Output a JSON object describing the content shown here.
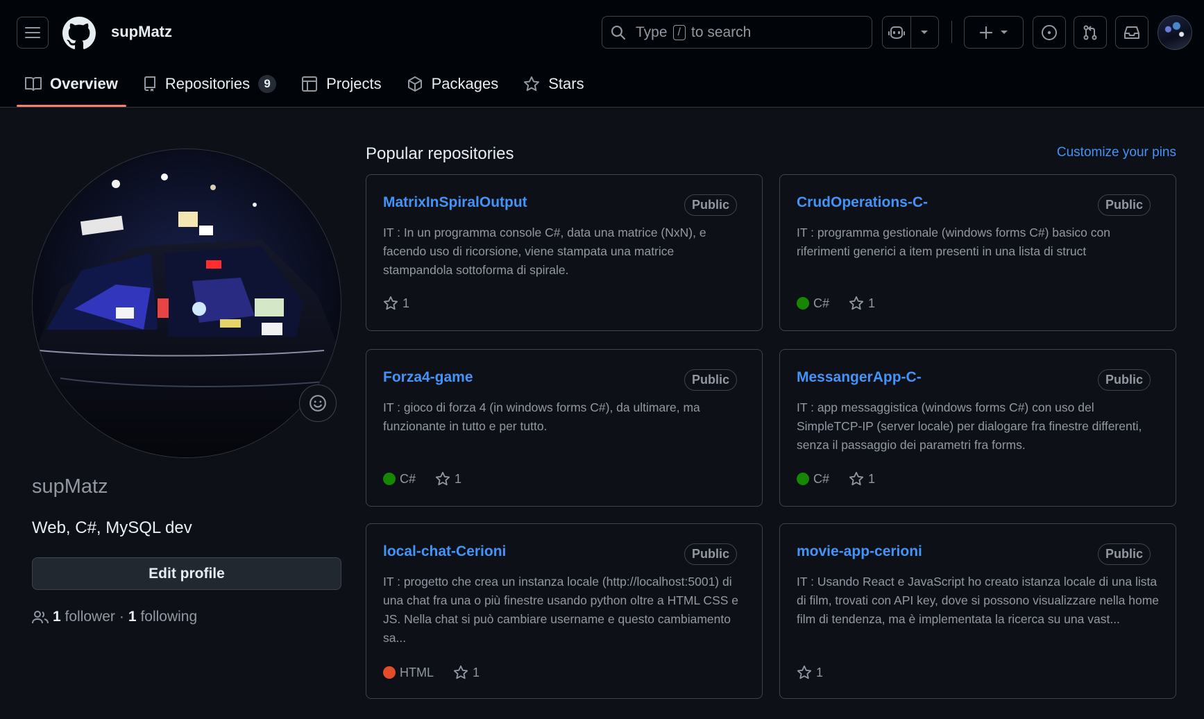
{
  "header": {
    "username": "supMatz",
    "search": {
      "prefix": "Type",
      "key": "/",
      "suffix": "to search"
    }
  },
  "tabs": [
    {
      "label": "Overview",
      "active": true
    },
    {
      "label": "Repositories",
      "count": "9"
    },
    {
      "label": "Projects"
    },
    {
      "label": "Packages"
    },
    {
      "label": "Stars"
    }
  ],
  "profile": {
    "login": "supMatz",
    "bio": "Web, C#, MySQL dev",
    "edit_label": "Edit profile",
    "followers_count": "1",
    "followers_label": "follower",
    "separator": "·",
    "following_count": "1",
    "following_label": "following"
  },
  "popular": {
    "title": "Popular repositories",
    "customize_label": "Customize your pins",
    "repos": [
      {
        "name": "MatrixInSpiralOutput",
        "visibility": "Public",
        "description": "IT : In un programma console C#, data una matrice (NxN), e facendo uso di ricorsione, viene stampata una matrice stampandola sottoforma di spirale.",
        "language": "",
        "stars": "1"
      },
      {
        "name": "CrudOperations-C-",
        "visibility": "Public",
        "description": "IT : programma gestionale (windows forms C#) basico con riferimenti generici a item presenti in una lista di struct",
        "language": "C#",
        "language_color": "#178600",
        "stars": "1"
      },
      {
        "name": "Forza4-game",
        "visibility": "Public",
        "description": "IT : gioco di forza 4 (in windows forms C#), da ultimare, ma funzionante in tutto e per tutto.",
        "language": "C#",
        "language_color": "#178600",
        "stars": "1"
      },
      {
        "name": "MessangerApp-C-",
        "visibility": "Public",
        "description": "IT : app messaggistica (windows forms C#) con uso del SimpleTCP-IP (server locale) per dialogare fra finestre differenti, senza il passaggio dei parametri fra forms.",
        "language": "C#",
        "language_color": "#178600",
        "stars": "1"
      },
      {
        "name": "local-chat-Cerioni",
        "visibility": "Public",
        "description": "IT : progetto che crea un instanza locale (http://localhost:5001) di una chat fra una o più finestre usando python oltre a HTML CSS e JS. Nella chat si può cambiare username e questo cambiamento sa...",
        "language": "HTML",
        "language_color": "#e34c26",
        "stars": "1"
      },
      {
        "name": "movie-app-cerioni",
        "visibility": "Public",
        "description": "IT : Usando React e JavaScript ho creato istanza locale di una lista di film, trovati con API key, dove si possono visualizzare nella home film di tendenza, ma è implementata la ricerca su una vast...",
        "language": "",
        "stars": "1"
      }
    ]
  },
  "colors": {
    "bg": "#0d1117",
    "header_bg": "#010409",
    "link": "#4493f8",
    "muted": "#9198a1",
    "tab_underline": "#f78166"
  }
}
